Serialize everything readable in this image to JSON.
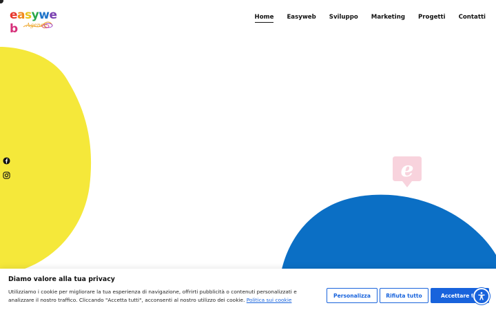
{
  "header": {
    "logo": {
      "word": "easyweb",
      "sub": "Agency"
    },
    "nav": [
      {
        "label": "Home",
        "active": true
      },
      {
        "label": "Easyweb",
        "active": false
      },
      {
        "label": "Sviluppo",
        "active": false
      },
      {
        "label": "Marketing",
        "active": false
      },
      {
        "label": "Progetti",
        "active": false
      },
      {
        "label": "Contatti",
        "active": false
      }
    ]
  },
  "social": [
    "facebook-icon",
    "instagram-icon"
  ],
  "colors": {
    "yellow_blob": "#f5e83a",
    "blue_blob": "#0b6fc5",
    "emblem_pink": "#f8d3dd",
    "accent": "#1863dc"
  },
  "cookie": {
    "title": "Diamo valore alla tua privacy",
    "text": "Utilizziamo i cookie per migliorare la tua esperienza di navigazione, offrirti pubblicità o contenuti personalizzati e analizzare il nostro traffico. Cliccando \"Accetta tutti\", acconsenti al nostro utilizzo dei cookie.",
    "policy_link": "Politica sui cookie",
    "buttons": {
      "customize": "Personalizza",
      "reject": "Rifiuta tutto",
      "accept": "Accettare tutti"
    }
  },
  "accessibility_icon": "accessibility-icon"
}
